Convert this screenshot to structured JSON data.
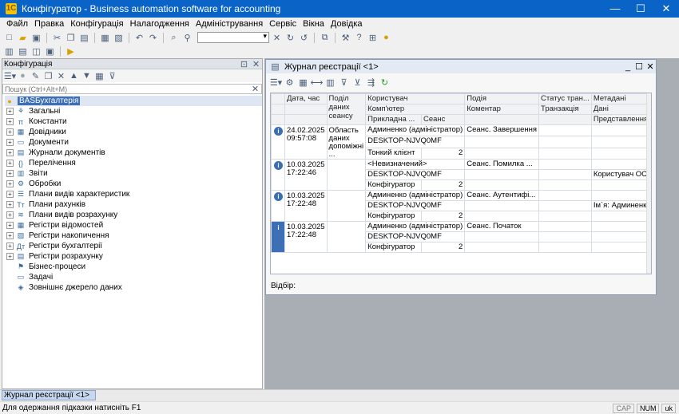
{
  "window": {
    "title": "Конфігуратор - Business automation software for accounting"
  },
  "menu": [
    "Файл",
    "Правка",
    "Конфігурація",
    "Налагодження",
    "Адміністрування",
    "Сервіс",
    "Вікна",
    "Довідка"
  ],
  "config_panel": {
    "title": "Конфігурація",
    "search_placeholder": "Пошук (Ctrl+Alt+M)",
    "root": "BASБухгалтерія",
    "items": [
      {
        "label": "Загальні",
        "icon": "common-icon",
        "expandable": true
      },
      {
        "label": "Константи",
        "icon": "constants-icon",
        "expandable": true
      },
      {
        "label": "Довідники",
        "icon": "catalogs-icon",
        "expandable": true
      },
      {
        "label": "Документи",
        "icon": "documents-icon",
        "expandable": true
      },
      {
        "label": "Журнали документів",
        "icon": "journals-icon",
        "expandable": true
      },
      {
        "label": "Перелічення",
        "icon": "enums-icon",
        "expandable": true
      },
      {
        "label": "Звіти",
        "icon": "reports-icon",
        "expandable": true
      },
      {
        "label": "Обробки",
        "icon": "processing-icon",
        "expandable": true
      },
      {
        "label": "Плани видів характеристик",
        "icon": "chart-char-icon",
        "expandable": true
      },
      {
        "label": "Плани рахунків",
        "icon": "chart-accounts-icon",
        "expandable": true
      },
      {
        "label": "Плани видів розрахунку",
        "icon": "chart-calc-icon",
        "expandable": true
      },
      {
        "label": "Регістри відомостей",
        "icon": "info-registers-icon",
        "expandable": true
      },
      {
        "label": "Регістри накопичення",
        "icon": "accum-registers-icon",
        "expandable": true
      },
      {
        "label": "Регістри бухгалтерії",
        "icon": "acc-registers-icon",
        "expandable": true
      },
      {
        "label": "Регістри розрахунку",
        "icon": "calc-registers-icon",
        "expandable": true
      },
      {
        "label": "Бізнес-процеси",
        "icon": "business-process-icon",
        "expandable": false
      },
      {
        "label": "Задачі",
        "icon": "tasks-icon",
        "expandable": false
      },
      {
        "label": "Зовнішнє джерело даних",
        "icon": "external-source-icon",
        "expandable": false
      }
    ]
  },
  "journal": {
    "title": "Журнал реєстрації <1>",
    "headers": {
      "date": "Дата, час",
      "sep": "Поділ даних сеансу",
      "user": "Користувач",
      "computer": "Комп'ютер",
      "app": "Прикладна ...",
      "session": "Сеанс",
      "event": "Подія",
      "comment": "Коментар",
      "status": "Статус тран...",
      "transaction": "Транзакція",
      "metadata": "Метадані",
      "data": "Дані",
      "data_repr": "Представлення даних"
    },
    "rows": [
      {
        "date": "24.02.2025",
        "time": "09:57:08",
        "sep": "Область даних допоміжні ...",
        "user": "Админенко (адміністратор)",
        "computer": "DESKTOP-NJVQ0MF",
        "app": "Тонкий клієнт",
        "session": "2",
        "event": "Сеанс. Завершення",
        "comment": "",
        "status": "",
        "transaction": "",
        "metadata": "",
        "data": "",
        "data_repr": ""
      },
      {
        "date": "10.03.2025",
        "time": "17:22:46",
        "sep": "",
        "user": "<Невизначений>",
        "computer": "DESKTOP-NJVQ0MF",
        "app": "Конфігуратор",
        "session": "2",
        "event": "Сеанс. Помилка ...",
        "comment": "",
        "status": "",
        "transaction": "",
        "metadata": "",
        "data": "",
        "data_repr": "Користувач ОС: DESKTO..."
      },
      {
        "date": "10.03.2025",
        "time": "17:22:48",
        "sep": "",
        "user": "Админенко (адміністратор)",
        "computer": "DESKTOP-NJVQ0MF",
        "app": "Конфігуратор",
        "session": "2",
        "event": "Сеанс. Аутентифі...",
        "comment": "",
        "status": "",
        "transaction": "",
        "metadata": "",
        "data": "",
        "data_repr": "Ім`я: Админенко (адміні..."
      },
      {
        "date": "10.03.2025",
        "time": "17:22:48",
        "sep": "",
        "user": "Админенко (адміністратор)",
        "computer": "DESKTOP-NJVQ0MF",
        "app": "Конфігуратор",
        "session": "2",
        "event": "Сеанс. Початок",
        "comment": "",
        "status": "",
        "transaction": "",
        "metadata": "",
        "data": "",
        "data_repr": ""
      }
    ],
    "filter_label": "Відбір:"
  },
  "taskbar": {
    "tab": "Журнал реєстрації <1>"
  },
  "status": {
    "hint": "Для одержання підказки натисніть F1",
    "cap": "CAP",
    "num": "NUM",
    "lang": "uk"
  }
}
